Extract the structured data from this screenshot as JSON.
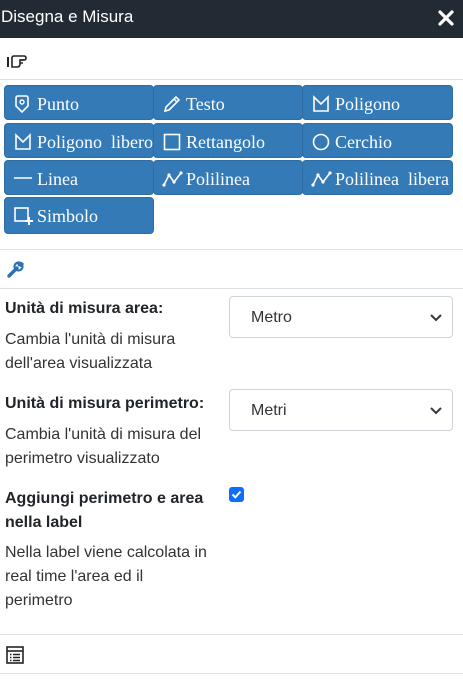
{
  "header": {
    "title": "Disegna e Misura"
  },
  "tools": [
    {
      "label": "Punto",
      "icon": "map-pin-icon"
    },
    {
      "label": "Testo",
      "icon": "pencil-icon"
    },
    {
      "label": "Poligono",
      "icon": "polygon-icon"
    },
    {
      "label": "Poligono  libero",
      "icon": "polygon-icon"
    },
    {
      "label": "Rettangolo",
      "icon": "square-icon"
    },
    {
      "label": "Cerchio",
      "icon": "circle-icon"
    },
    {
      "label": "Linea",
      "icon": "line-icon"
    },
    {
      "label": "Polilinea",
      "icon": "polyline-icon"
    },
    {
      "label": "Polilinea  libera",
      "icon": "polyline-icon"
    },
    {
      "label": "Simbolo",
      "icon": "symbol-add-icon"
    }
  ],
  "settings": {
    "area": {
      "label": "Unità di misura area:",
      "desc_line1": "Cambia l'unità di misura",
      "desc_line2": "dell'area visualizzata",
      "value": "Metro"
    },
    "perimeter": {
      "label": "Unità di misura perimetro:",
      "desc_line1": "Cambia l'unità di misura del",
      "desc_line2": "perimetro visualizzato",
      "value": "Metri"
    },
    "label_toggle": {
      "label_line1": "Aggiungi perimetro e area",
      "label_line2": "nella label",
      "desc_line1": "Nella label viene calcolata in",
      "desc_line2": "real time l'area ed il",
      "desc_line3": "perimetro",
      "checked": true
    }
  },
  "colors": {
    "header_bg": "#222b33",
    "button_bg": "#337ab7",
    "checkbox": "#0d6efd"
  }
}
